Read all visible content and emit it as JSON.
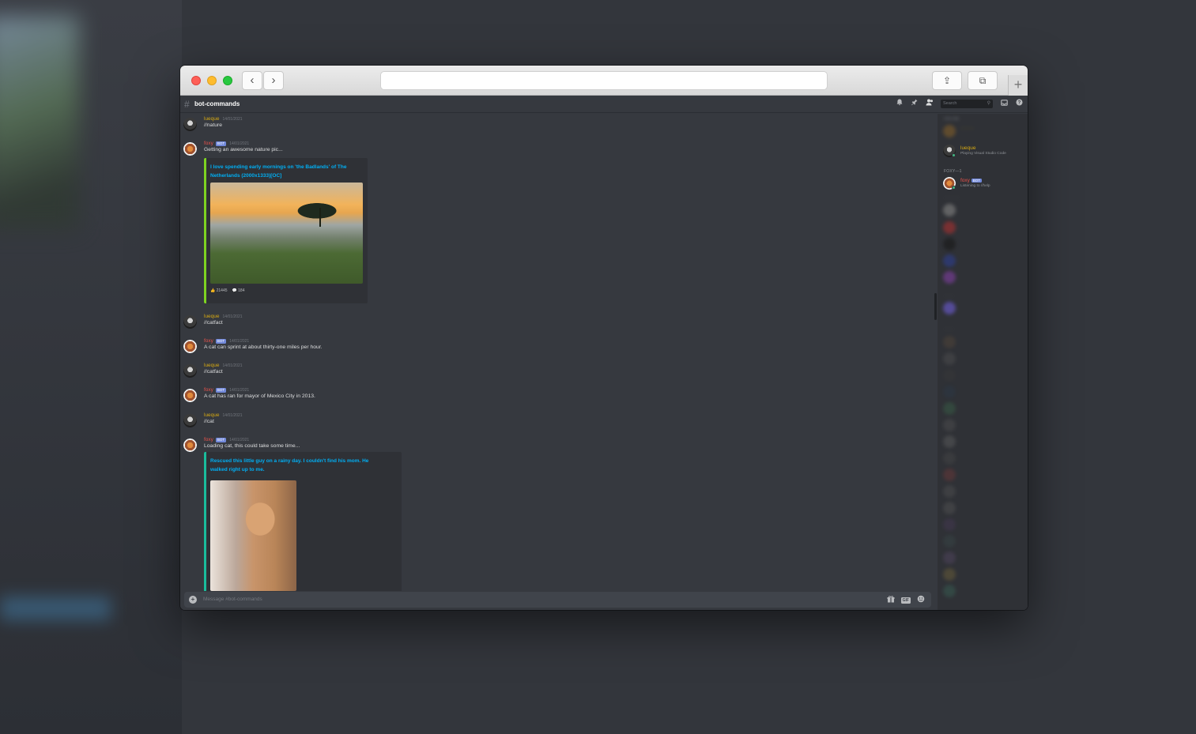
{
  "browser": {
    "back_label": "‹",
    "forward_label": "›",
    "share_label": "⇪",
    "tabs_label": "⧉",
    "new_tab_label": "+"
  },
  "channel": {
    "hash": "#",
    "name": "bot-commands",
    "search_placeholder": "Search"
  },
  "messages": [
    {
      "author": "lueque",
      "timestamp": "14/01/2021",
      "text": "//nature"
    },
    {
      "author": "foxy",
      "bot": "BOT",
      "timestamp": "14/01/2021",
      "text": "Getting an awesome nature pic...",
      "embed": {
        "title_line1": "I love spending early mornings on 'the Badlands' of The",
        "title_line2": "Netherlands (2000x1333)[OC]",
        "upvotes": "21445",
        "comments": "184"
      }
    },
    {
      "author": "lueque",
      "timestamp": "14/01/2021",
      "text": "//catfact"
    },
    {
      "author": "foxy",
      "bot": "BOT",
      "timestamp": "14/01/2021",
      "text": "A cat can sprint at about thirty-one miles per hour."
    },
    {
      "author": "lueque",
      "timestamp": "14/01/2021",
      "text": "//catfact"
    },
    {
      "author": "foxy",
      "bot": "BOT",
      "timestamp": "14/01/2021",
      "text": "A cat has ran for mayor of Mexico City in 2013."
    },
    {
      "author": "lueque",
      "timestamp": "14/01/2021",
      "text": "//cat"
    },
    {
      "author": "foxy",
      "bot": "BOT",
      "timestamp": "14/01/2021",
      "text": "Loading cat, this could take some time...",
      "embed": {
        "title_line1": "Rescued this little guy on a rainy day. I couldn't find his mom. He",
        "title_line2": "walked right up to me."
      }
    }
  ],
  "input": {
    "placeholder": "Message #bot-commands",
    "gif_label": "GIF"
  },
  "members": {
    "owner": {
      "name": "lueque",
      "status": "Playing Visual Studio Code"
    },
    "foxy_heading": "FOXY—1",
    "foxy": {
      "name": "foxy",
      "bot": "BOT",
      "status": "Listening to //help"
    }
  },
  "colors": {
    "user_name": "#d6a912",
    "bot_name": "#e8524b",
    "bot_badge": "#7289da",
    "link": "#00aff4",
    "embed_border_nature": "#7ed321",
    "embed_border_cat": "#1abc9c"
  }
}
